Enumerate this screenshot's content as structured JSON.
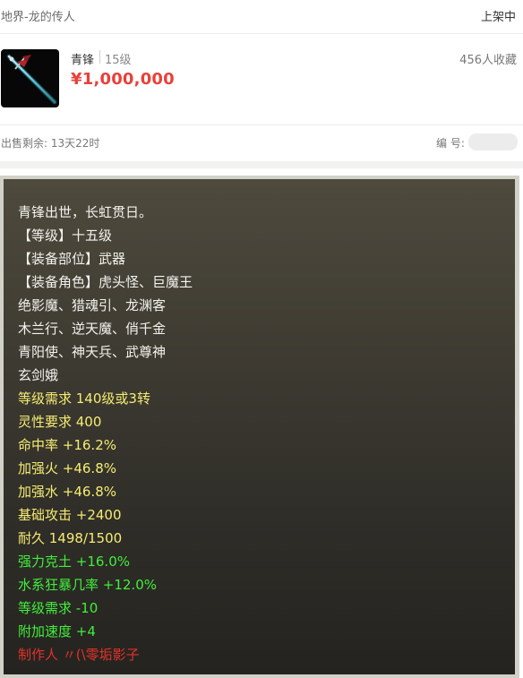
{
  "header": {
    "server_name": "地界-龙的传人",
    "listing_status": "上架中"
  },
  "item": {
    "name": "青锋",
    "level": "15级",
    "price": "¥1,000,000",
    "favorites": "456人收藏",
    "thumbnail_icon": "sword-icon"
  },
  "meta": {
    "time_left": "出售剩余: 13天22时",
    "serial_label": "编 号:",
    "serial_value": ""
  },
  "tooltip": {
    "colors": {
      "white": "#f2f2ee",
      "yellow": "#f5ec72",
      "green": "#42ee3c",
      "red": "#e2322a"
    },
    "lines": [
      {
        "text": "青锋出世，长虹贯日。",
        "color": "white"
      },
      {
        "text": "【等级】十五级",
        "color": "white"
      },
      {
        "text": "【装备部位】武器",
        "color": "white"
      },
      {
        "text": "【装备角色】虎头怪、巨魔王",
        "color": "white"
      },
      {
        "text": "绝影魔、猎魂引、龙渊客",
        "color": "white"
      },
      {
        "text": "木兰行、逆天魔、俏千金",
        "color": "white"
      },
      {
        "text": "青阳使、神天兵、武尊神",
        "color": "white"
      },
      {
        "text": "玄剑娥",
        "color": "white"
      },
      {
        "text": "等级需求 140级或3转",
        "color": "yellow"
      },
      {
        "text": "灵性要求 400",
        "color": "yellow"
      },
      {
        "text": "命中率 +16.2%",
        "color": "yellow"
      },
      {
        "text": "加强火 +46.8%",
        "color": "yellow"
      },
      {
        "text": "加强水 +46.8%",
        "color": "yellow"
      },
      {
        "text": "基础攻击 +2400",
        "color": "yellow"
      },
      {
        "text": "耐久 1498/1500",
        "color": "yellow"
      },
      {
        "text": "强力克土 +16.0%",
        "color": "green"
      },
      {
        "text": "水系狂暴几率 +12.0%",
        "color": "green"
      },
      {
        "text": "等级需求 -10",
        "color": "green"
      },
      {
        "text": "附加速度 +4",
        "color": "green"
      },
      {
        "text": "制作人 〃(\\零垢影子",
        "color": "red"
      }
    ]
  }
}
